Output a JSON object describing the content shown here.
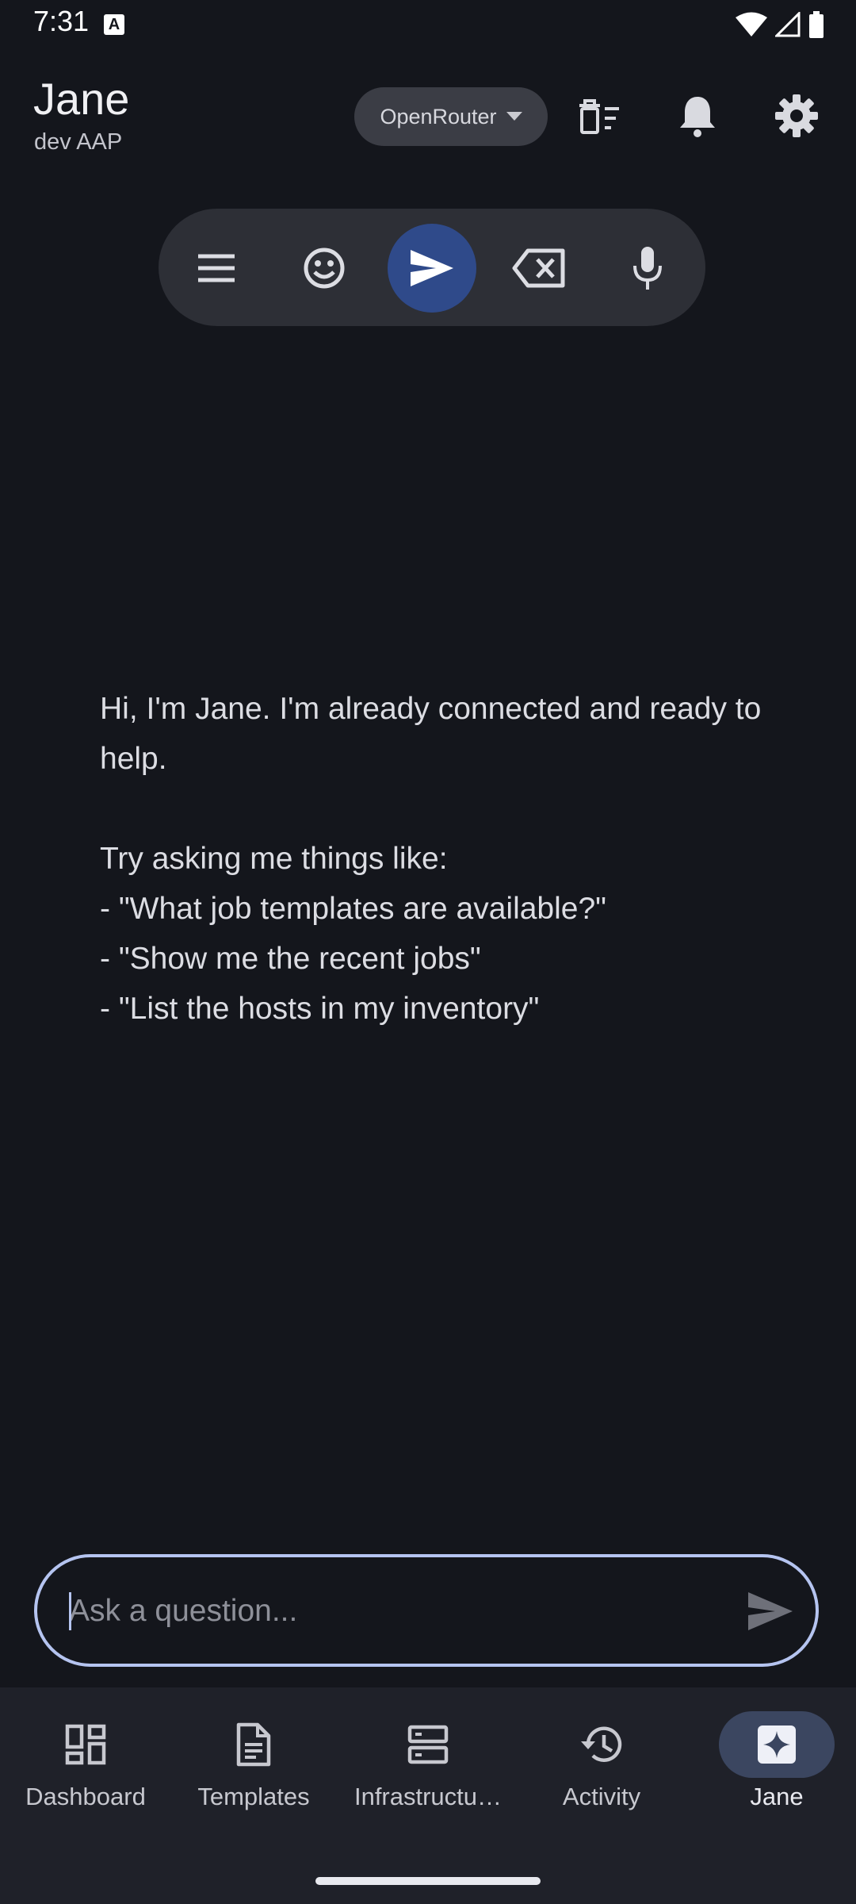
{
  "status": {
    "time": "7:31",
    "notification_glyph": "A"
  },
  "header": {
    "title": "Jane",
    "subtitle": "dev AAP",
    "provider": "OpenRouter",
    "icons": [
      "clear-history-icon",
      "bell-icon",
      "gear-icon"
    ]
  },
  "toolbar": {
    "icons": [
      "menu-icon",
      "emoji-icon",
      "send-icon",
      "backspace-icon",
      "mic-icon"
    ],
    "active": "send-icon",
    "accent": "#2f4a8a"
  },
  "chat": {
    "greeting": "Hi, I'm Jane. I'm already connected and ready to help.\n\nTry asking me things like:\n- \"What job templates are available?\"\n- \"Show me the recent jobs\"\n- \"List the hosts in my inventory\""
  },
  "input": {
    "placeholder": "Ask a question...",
    "value": ""
  },
  "nav": {
    "items": [
      {
        "label": "Dashboard",
        "icon": "dashboard-icon"
      },
      {
        "label": "Templates",
        "icon": "document-icon"
      },
      {
        "label": "Infrastructu…",
        "icon": "server-icon"
      },
      {
        "label": "Activity",
        "icon": "history-icon"
      },
      {
        "label": "Jane",
        "icon": "sparkle-icon"
      }
    ],
    "active": "Jane"
  }
}
